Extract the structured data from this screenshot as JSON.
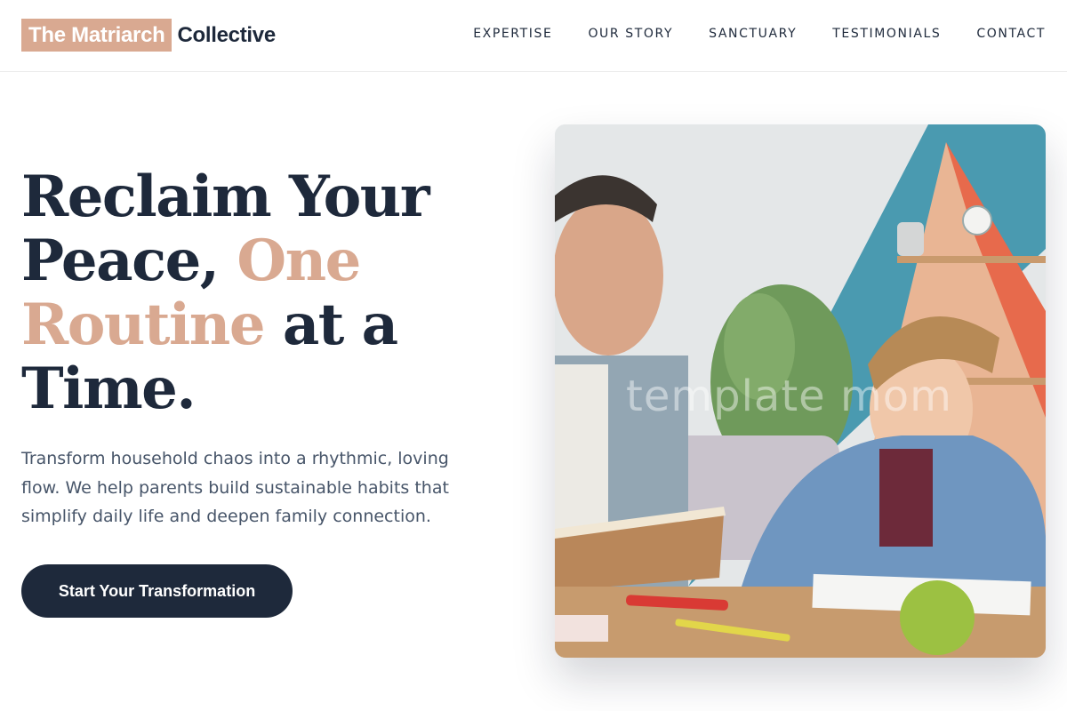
{
  "header": {
    "logo_highlight": "The Matriarch",
    "logo_rest": "Collective",
    "nav": [
      "EXPERTISE",
      "OUR STORY",
      "SANCTUARY",
      "TESTIMONIALS",
      "CONTACT"
    ]
  },
  "hero": {
    "title_line1": "Reclaim Your",
    "title_peace": "Peace, ",
    "title_one": "One",
    "title_routine": "Routine",
    "title_at_a": " at a",
    "title_time": "Time.",
    "subtitle": "Transform household chaos into a rhythmic, loving flow. We help parents build sustainable habits that simplify daily life and deepen family connection.",
    "cta_label": "Start Your Transformation"
  },
  "photo": {
    "watermark": "template mom"
  },
  "colors": {
    "primary": "#1e293b",
    "accent": "#d9a991",
    "muted_text": "#475569"
  }
}
